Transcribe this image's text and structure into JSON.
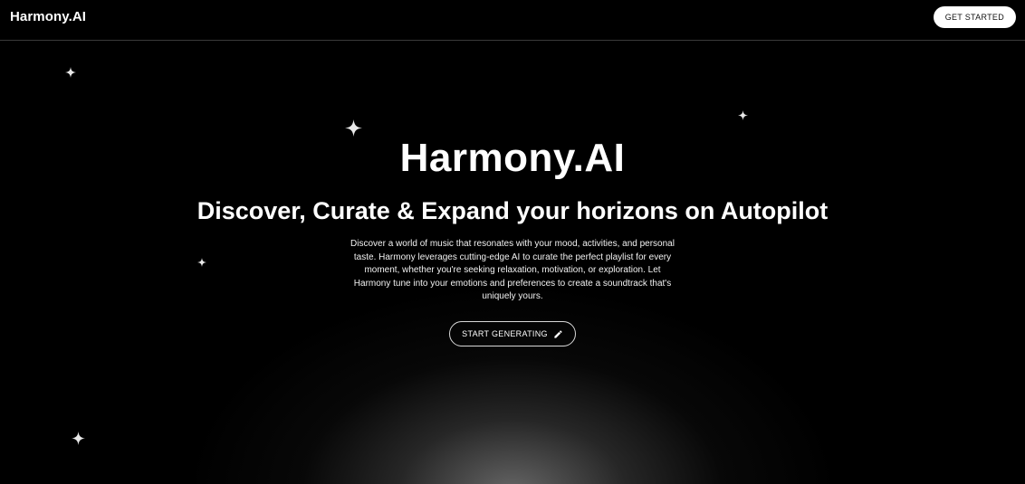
{
  "header": {
    "brand": "Harmony.AI",
    "cta_label": "GET STARTED"
  },
  "hero": {
    "title": "Harmony.AI",
    "subtitle": "Discover, Curate & Expand your horizons on Autopilot",
    "description": "Discover a world of music that resonates with your mood, activities, and personal taste. Harmony leverages cutting-edge AI to curate the perfect playlist for every moment, whether you're seeking relaxation, motivation, or exploration. Let Harmony tune into your emotions and preferences to create a soundtrack that's uniquely yours.",
    "cta_label": "START GENERATING",
    "cta_icon": "pencil-icon"
  },
  "decor": {
    "sparkle_icon": "sparkle-icon",
    "sparkle_color": "#e8e8e8"
  },
  "colors": {
    "background": "#000000",
    "text": "#ffffff",
    "button_bg": "#ffffff"
  }
}
